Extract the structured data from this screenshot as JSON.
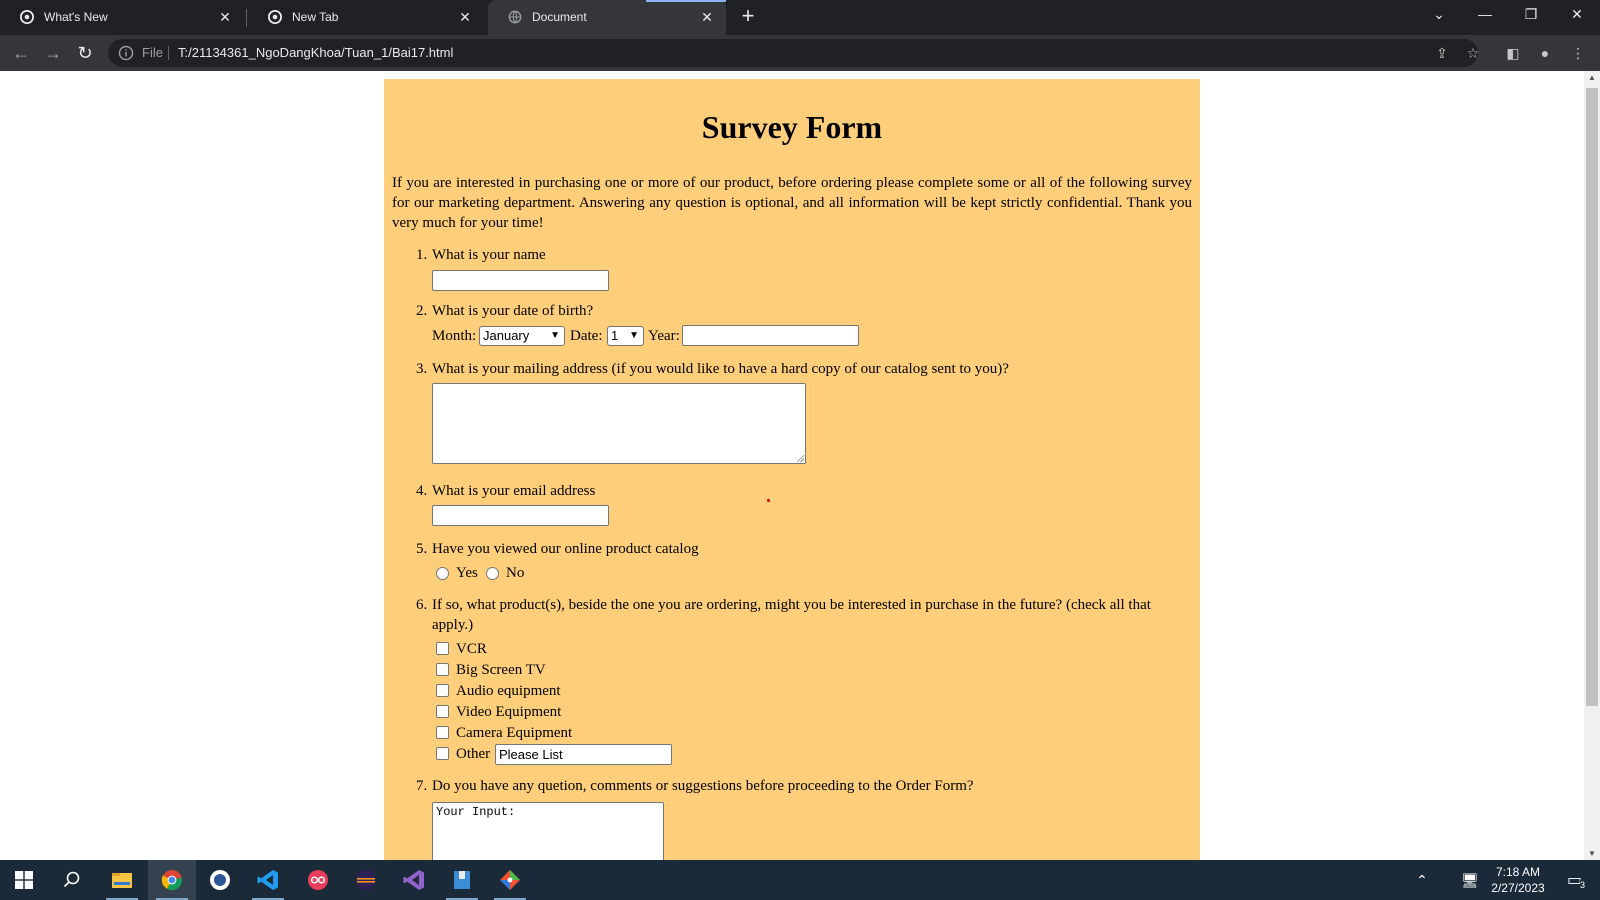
{
  "browser": {
    "tabs": [
      {
        "label": "What's New",
        "active": false
      },
      {
        "label": "New Tab",
        "active": false
      },
      {
        "label": "Document",
        "active": true
      }
    ],
    "new_tab_icon": "plus-icon",
    "window_controls": [
      "chevron-down-icon",
      "minimize-icon",
      "restore-icon",
      "close-icon"
    ],
    "address": {
      "scheme_label": "File",
      "url": "T:/21134361_NgoDangKhoa/Tuan_1/Bai17.html"
    }
  },
  "page": {
    "title": "Survey Form",
    "intro": "If you are interested in purchasing one or more of our product, before ordering please complete some or all of the following survey for our marketing department. Answering any question is optional, and all information will be kept strictly confidential. Thank you very much for your time!",
    "questions": [
      {
        "num": "1.",
        "text": "What is your name"
      },
      {
        "num": "2.",
        "text": "What is your date of birth?"
      },
      {
        "num": "3.",
        "text": "What is your mailing address (if you would like to have a hard copy of our catalog sent to you)?"
      },
      {
        "num": "4.",
        "text": "What is your email address"
      },
      {
        "num": "5.",
        "text": "Have you viewed our online product catalog"
      },
      {
        "num": "6.",
        "text": "If so, what product(s), beside the one you are ordering, might you be interested in purchase in the future? (check all that",
        "text2": "apply.)"
      },
      {
        "num": "7.",
        "text": "Do you have any quetion, comments or suggestions before proceeding to the Order Form?"
      }
    ],
    "dob": {
      "month_label": "Month:",
      "month_value": "January",
      "date_label": "Date:",
      "date_value": "1",
      "year_label": "Year:",
      "year_value": ""
    },
    "name_value": "",
    "address_value": "",
    "email_value": "",
    "catalog_options": [
      "Yes",
      "No"
    ],
    "products": [
      "VCR",
      "Big Screen TV",
      "Audio equipment",
      "Video Equipment",
      "Camera Equipment",
      "Other"
    ],
    "other_value": "Please List",
    "comments_value": "Your Input:"
  },
  "taskbar": {
    "apps": [
      "windows-start-icon",
      "search-icon",
      "file-explorer-icon",
      "chrome-icon",
      "app-icon",
      "vscode-icon",
      "app-icon",
      "eclipse-icon",
      "visual-studio-icon",
      "app-icon",
      "git-icon"
    ],
    "time": "7:18 AM",
    "date": "2/27/2023",
    "notification_count": "3"
  }
}
